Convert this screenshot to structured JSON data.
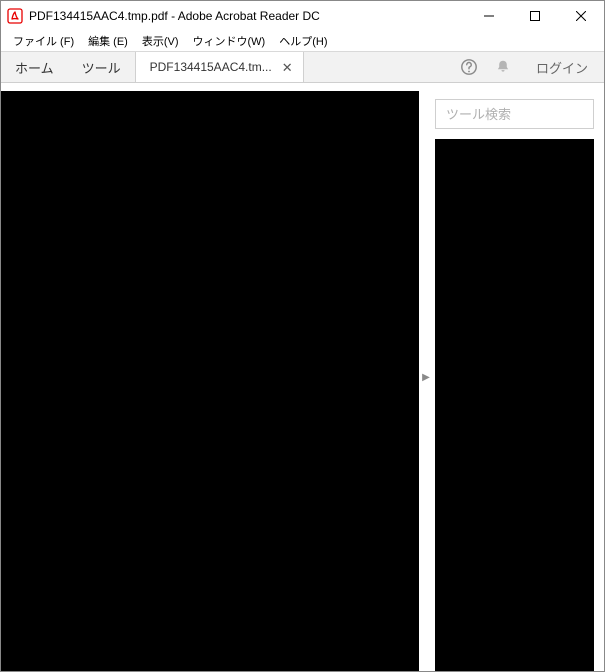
{
  "titlebar": {
    "title": "PDF134415AAC4.tmp.pdf - Adobe Acrobat Reader DC"
  },
  "menubar": {
    "file": "ファイル (F)",
    "edit": "編集 (E)",
    "view": "表示(V)",
    "window": "ウィンドウ(W)",
    "help": "ヘルプ(H)"
  },
  "tabs": {
    "home": "ホーム",
    "tools": "ツール",
    "doc_label": "PDF134415AAC4.tm...",
    "login": "ログイン"
  },
  "right_pane": {
    "search_placeholder": "ツール検索"
  }
}
